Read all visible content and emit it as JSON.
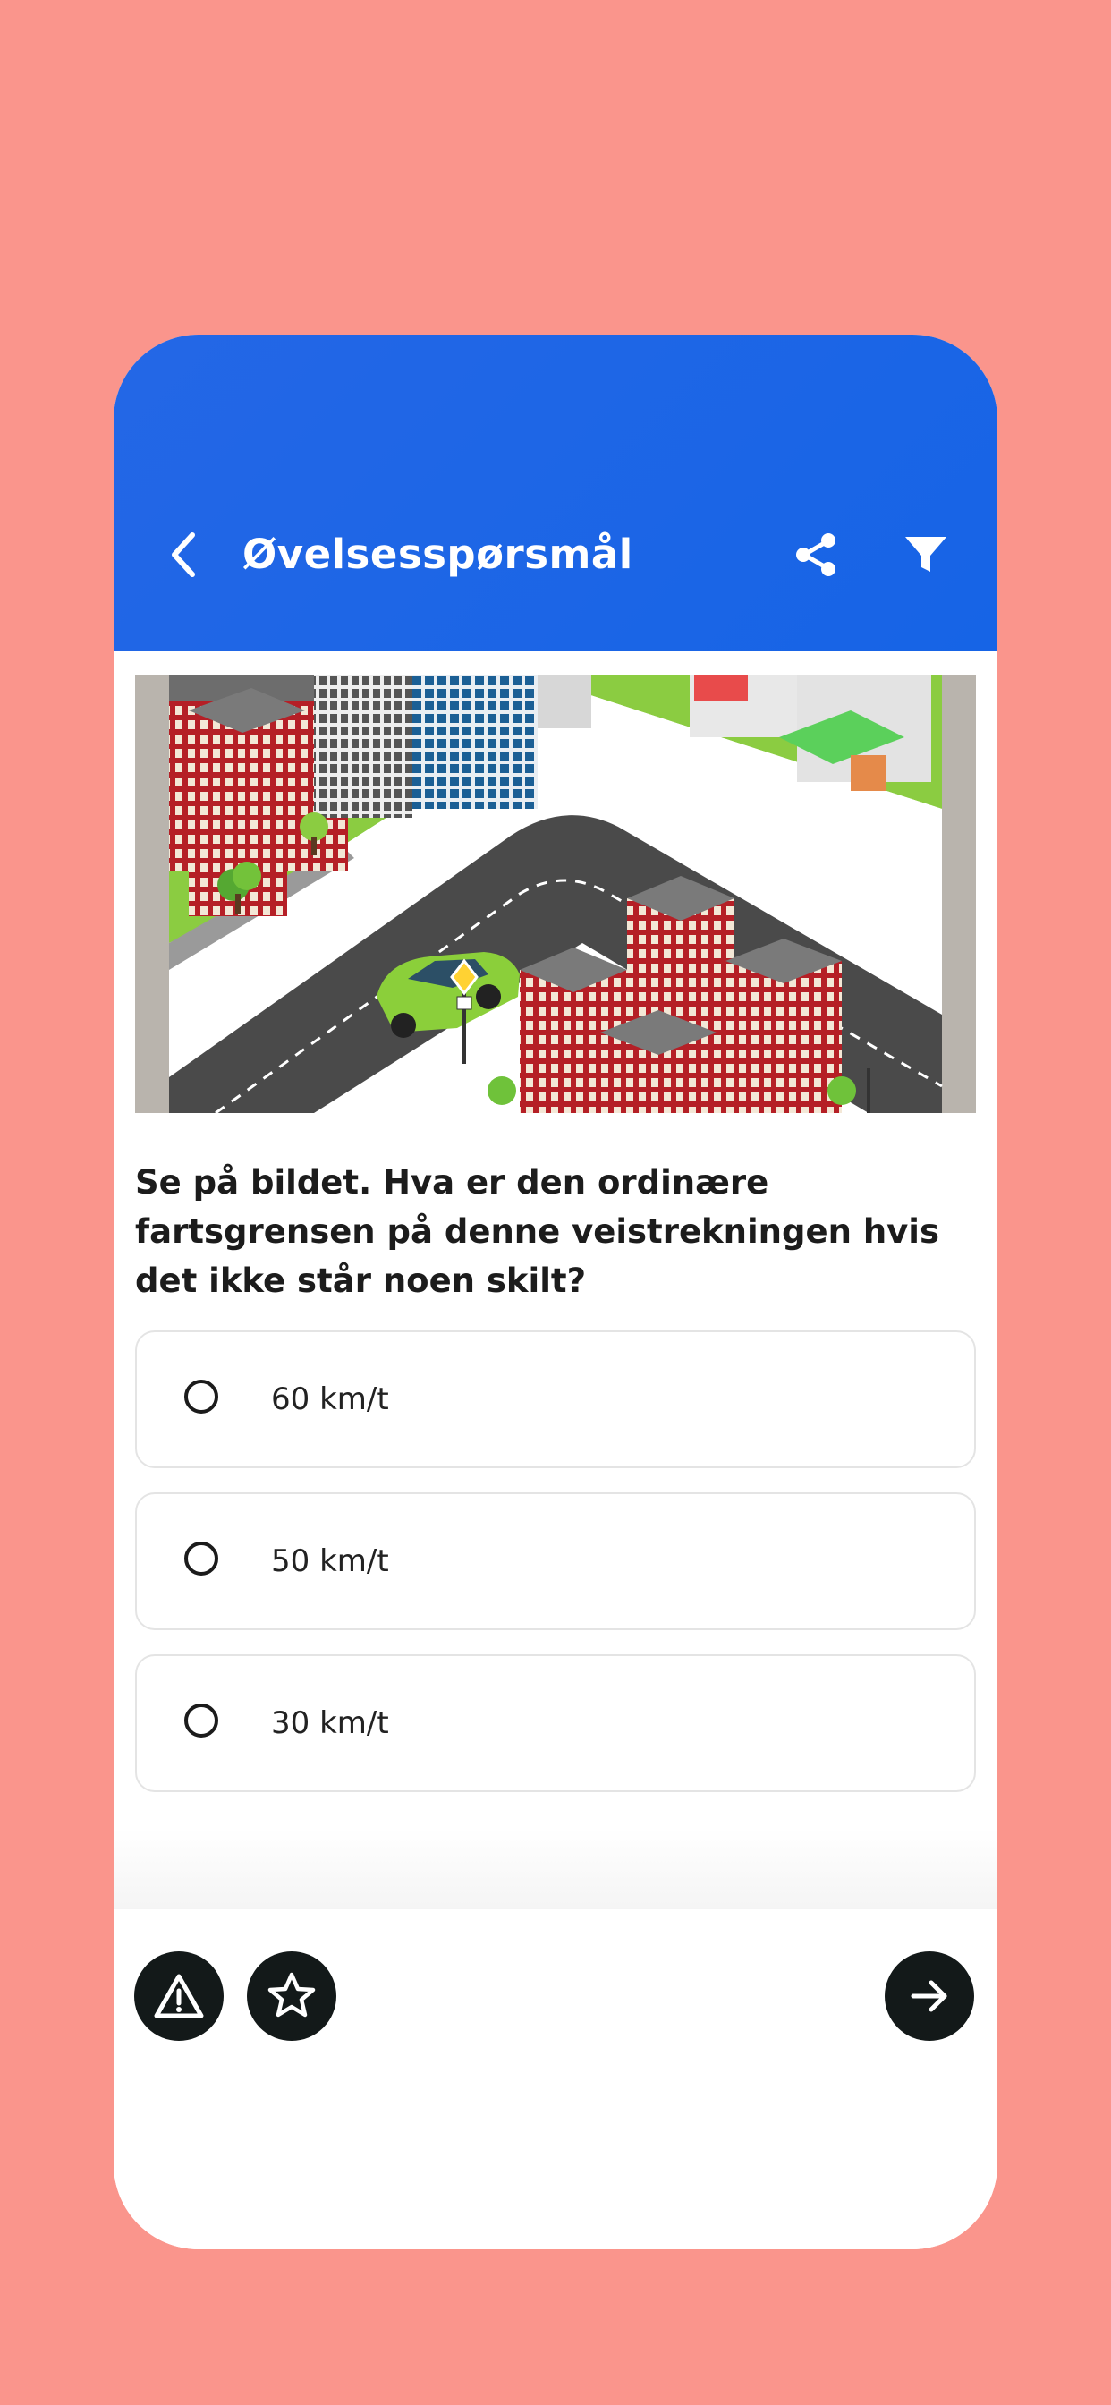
{
  "header": {
    "title": "Øvelsesspørsmål",
    "background": "#1664e6",
    "back_icon": "chevron-left-icon",
    "share_icon": "share-icon",
    "filter_icon": "filter-icon"
  },
  "question": {
    "text": "Se på bildet. Hva er den ordinære fartsgrensen på denne veistrekningen hvis det ikke står noen skilt?",
    "image": "isometric-city-street-with-car-and-priority-road-sign"
  },
  "options": [
    {
      "label": "60 km/t",
      "selected": false
    },
    {
      "label": "50 km/t",
      "selected": false
    },
    {
      "label": "30 km/t",
      "selected": false
    }
  ],
  "footer": {
    "report_icon": "warning-icon",
    "favorite_icon": "star-icon",
    "next_icon": "arrow-right-icon",
    "button_color": "#131919"
  },
  "colors": {
    "page_background": "#fa958c",
    "card_background": "#ffffff"
  }
}
